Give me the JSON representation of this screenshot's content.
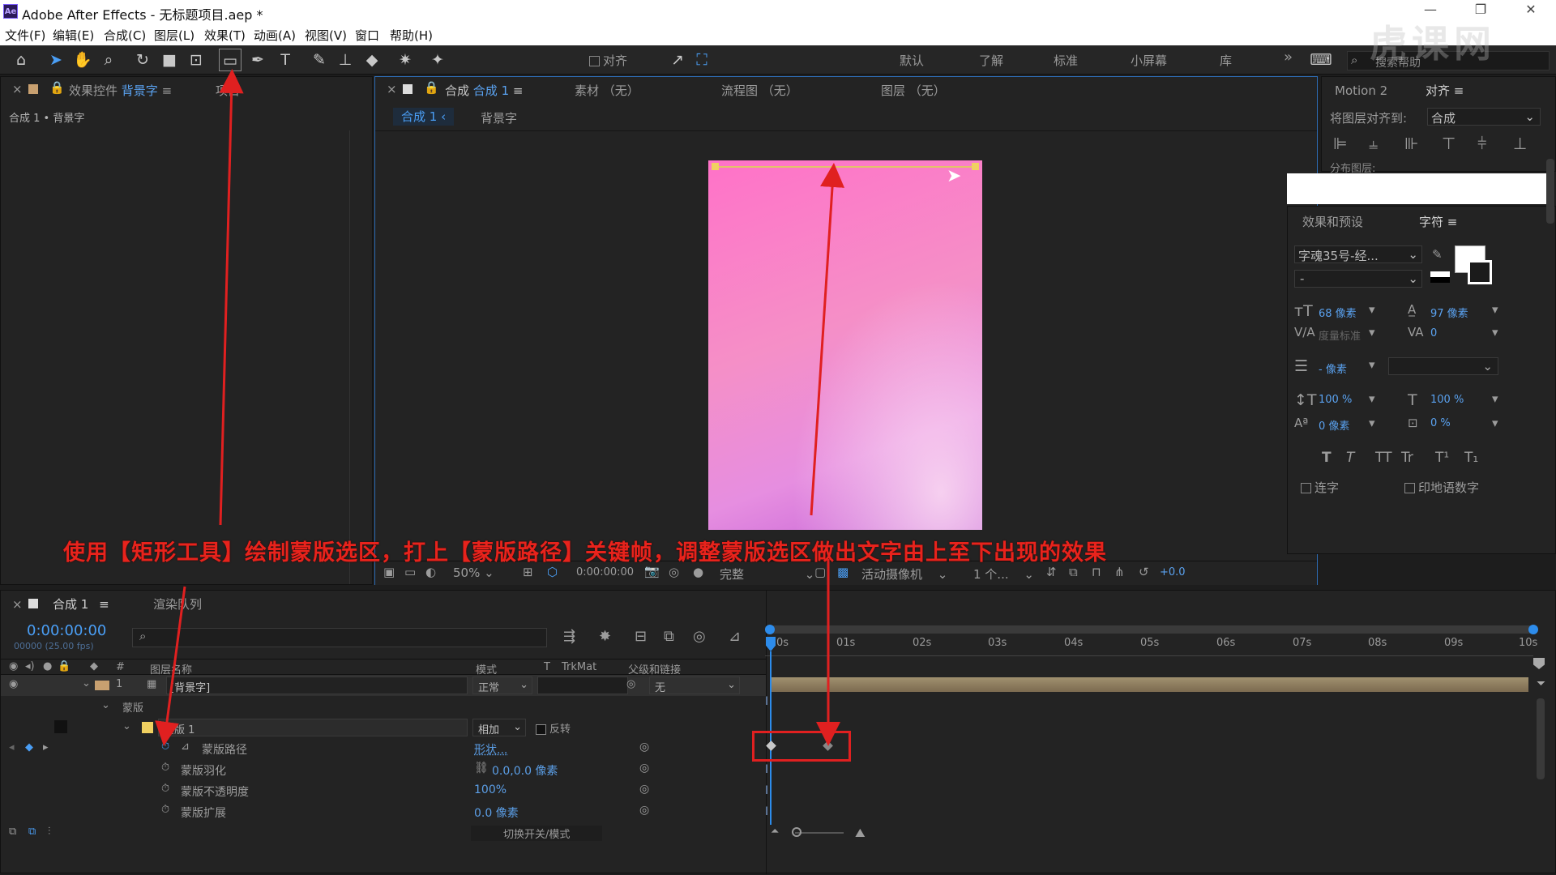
{
  "window": {
    "title": "Adobe After Effects - 无标题项目.aep *",
    "app_badge": "Ae",
    "min": "—",
    "restore": "❐",
    "close": "✕"
  },
  "menu": [
    "文件(F)",
    "编辑(E)",
    "合成(C)",
    "图层(L)",
    "效果(T)",
    "动画(A)",
    "视图(V)",
    "窗口",
    "帮助(H)"
  ],
  "toolbar": {
    "align_label": "对齐",
    "workspaces": [
      "默认",
      "了解",
      "标准",
      "小屏幕",
      "库"
    ],
    "more": "»",
    "search_placeholder": "搜索帮助"
  },
  "effect_panel": {
    "tab_prefix": "效果控件",
    "tab_layer": "背景字",
    "tab_project": "项目",
    "breadcrumb": "合成 1 • 背景字"
  },
  "viewer": {
    "tab_prefix": "合成",
    "tab_name": "合成 1",
    "tab_footage": "素材 （无）",
    "tab_flow": "流程图 （无）",
    "tab_layer": "图层 （无）",
    "nav_comp": "合成 1",
    "nav_layer": "背景字",
    "zoom": "50%",
    "timecode": "0:00:00:00",
    "resolution": "完整",
    "camera": "活动摄像机",
    "views": "1 个...",
    "exposure": "+0.0"
  },
  "right_panel": {
    "tab_motion": "Motion 2",
    "tab_align": "对齐",
    "align_to_label": "将图层对齐到:",
    "align_to_value": "合成",
    "distribute_label": "分布图层:",
    "tab_effects": "效果和预设",
    "tab_char": "字符",
    "font_name": "字魂35号-经...",
    "font_style": "-",
    "font_size": "68 像素",
    "leading": "97 像素",
    "kerning": "度量标准",
    "tracking": "0",
    "stroke_width": "- 像素",
    "vscale": "100 %",
    "hscale": "100 %",
    "baseline": "0 像素",
    "tsume": "0 %",
    "ligature": "连字",
    "hindi": "印地语数字",
    "styles": [
      "T",
      "T",
      "TT",
      "Tr",
      "T¹",
      "T₁"
    ]
  },
  "annotation": "使用【矩形工具】绘制蒙版选区，打上【蒙版路径】关键帧，调整蒙版选区做出文字由上至下出现的效果",
  "timeline": {
    "tab_comp": "合成 1",
    "tab_render": "渲染队列",
    "timecode": "0:00:00:00",
    "frames": "00000 (25.00 fps)",
    "col_name": "图层名称",
    "col_mode": "模式",
    "col_t": "T",
    "col_trkmat": "TrkMat",
    "col_parent": "父级和链接",
    "col_num": "#",
    "ticks": [
      "0s",
      "01s",
      "02s",
      "03s",
      "04s",
      "05s",
      "06s",
      "07s",
      "08s",
      "09s",
      "10s"
    ],
    "layer": {
      "num": "1",
      "name": "[背景字]",
      "mode": "正常",
      "parent": "无"
    },
    "mask_group": "蒙版",
    "mask_name": "蒙版 1",
    "mask_mode": "相加",
    "invert": "反转",
    "props": [
      {
        "name": "蒙版路径",
        "value": "形状..."
      },
      {
        "name": "蒙版羽化",
        "value": "0.0,0.0 像素"
      },
      {
        "name": "蒙版不透明度",
        "value": "100%"
      },
      {
        "name": "蒙版扩展",
        "value": "0.0 像素"
      }
    ],
    "switch_modes": "切换开关/模式"
  },
  "watermark": "虎课网",
  "colors": {
    "accent": "#2d8ceb",
    "annotation": "#e8231c",
    "gradient_top": "#ff6ec7",
    "gradient_bottom": "#c862d8",
    "layer_bar": "#8c7a5e"
  }
}
